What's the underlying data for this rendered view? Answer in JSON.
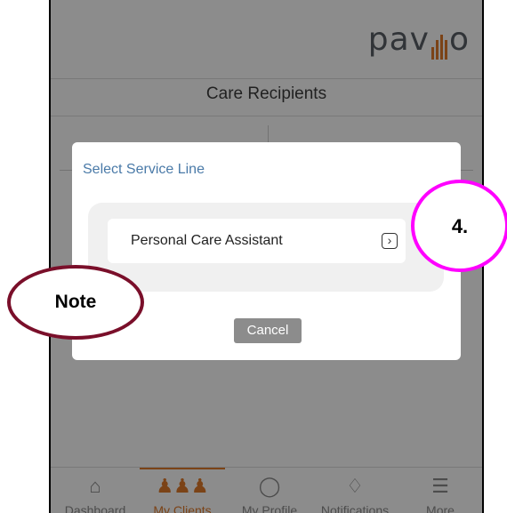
{
  "header": {
    "logo_text": "pavillio"
  },
  "page": {
    "title": "Care Recipients"
  },
  "modal": {
    "title": "Select Service Line",
    "options": [
      {
        "label": "Personal Care Assistant",
        "icon": "chevron-right-icon"
      }
    ],
    "cancel_label": "Cancel"
  },
  "nav": {
    "items": [
      {
        "label": "Dashboard",
        "icon": "home-icon"
      },
      {
        "label": "My Clients",
        "icon": "clients-icon",
        "active": true
      },
      {
        "label": "My Profile",
        "icon": "profile-icon"
      },
      {
        "label": "Notifications",
        "icon": "bell-icon"
      },
      {
        "label": "More",
        "icon": "menu-icon"
      }
    ]
  },
  "annotations": {
    "note": "Note",
    "step": "4."
  },
  "colors": {
    "accent": "#e07a2a",
    "link_blue": "#4a7aa8",
    "note_border": "#7a0f2a",
    "step_border": "#ff00ff"
  }
}
